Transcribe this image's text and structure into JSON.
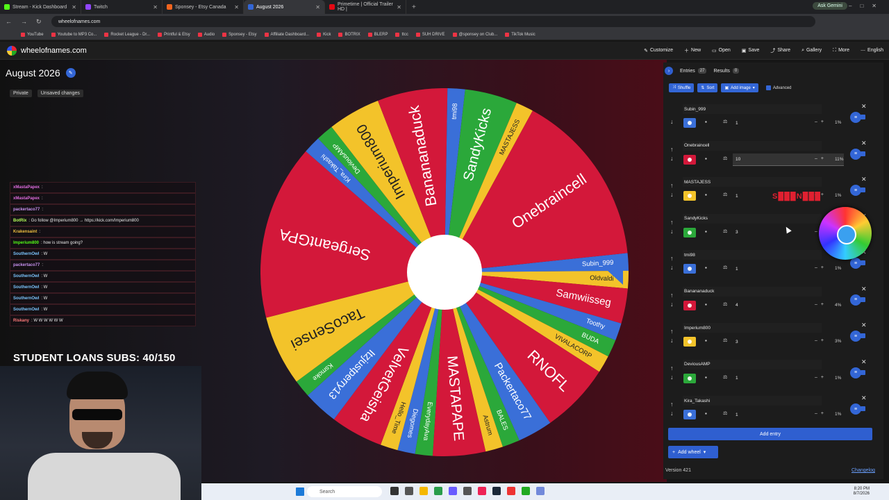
{
  "browser": {
    "tabs": [
      {
        "label": "Stream - Kick Dashboard",
        "color": "#53fc18"
      },
      {
        "label": "Twitch",
        "color": "#9146ff"
      },
      {
        "label": "Sponsey - Etsy Canada",
        "color": "#f1641e"
      },
      {
        "label": "August 2026",
        "color": "#3366d6",
        "active": true
      },
      {
        "label": "Primetime | Official Trailer HD |",
        "color": "#e50914"
      }
    ],
    "ask_gemini": "Ask Gemini",
    "url": "wheelofnames.com",
    "bookmarks": [
      "YouTube",
      "Youtube to MP3 Co...",
      "Rocket League - Dr...",
      "Printful & Etsy",
      "Audio",
      "Sponsey - Etsy",
      "Affiliate Dashboard...",
      "Kick",
      "BOTRIX",
      "BLERP",
      "ttcc",
      "SUH DRIVE",
      "@sponsey on Club...",
      "TikTok Music"
    ]
  },
  "site": {
    "logo": "wheelofnames.com",
    "menu": [
      "Customize",
      "New",
      "Open",
      "Save",
      "Share",
      "Gallery",
      "More",
      "English"
    ]
  },
  "wheel": {
    "title": "August 2026",
    "badges": [
      "Private",
      "Unsaved changes"
    ],
    "segments": [
      {
        "name": "Subin_999",
        "color": "#3a6fd8",
        "weight": 1
      },
      {
        "name": "Oldvaldi",
        "color": "#f3c32a",
        "weight": 1
      },
      {
        "name": "Samwiisseg",
        "color": "#d3183a",
        "weight": 2
      },
      {
        "name": "Toothy",
        "color": "#3a6fd8",
        "weight": 1
      },
      {
        "name": "BUDA",
        "color": "#2ba83a",
        "weight": 1
      },
      {
        "name": "VIVALACORP",
        "color": "#f3c32a",
        "weight": 1
      },
      {
        "name": "RNOFL",
        "color": "#d3183a",
        "weight": 4
      },
      {
        "name": "Packertaco77",
        "color": "#3a6fd8",
        "weight": 2
      },
      {
        "name": "BALES",
        "color": "#2ba83a",
        "weight": 1
      },
      {
        "name": "Astrum",
        "color": "#f3c32a",
        "weight": 1
      },
      {
        "name": "MASTAPAPE",
        "color": "#d3183a",
        "weight": 3
      },
      {
        "name": "EverydayAva",
        "color": "#2ba83a",
        "weight": 1
      },
      {
        "name": "Diegomes",
        "color": "#3a6fd8",
        "weight": 1
      },
      {
        "name": "Hello_Time",
        "color": "#f3c32a",
        "weight": 1
      },
      {
        "name": "VelvetGeisha",
        "color": "#d3183a",
        "weight": 3
      },
      {
        "name": "Itzjustperry13",
        "color": "#3a6fd8",
        "weight": 2
      },
      {
        "name": "Ksmoke",
        "color": "#2ba83a",
        "weight": 1
      },
      {
        "name": "TacoSensei",
        "color": "#f3c32a",
        "weight": 4
      },
      {
        "name": "SergeantGPA",
        "color": "#d3183a",
        "weight": 10
      },
      {
        "name": "Kira_Takashi",
        "color": "#3a6fd8",
        "weight": 1
      },
      {
        "name": "DeviousAMP",
        "color": "#2ba83a",
        "weight": 1
      },
      {
        "name": "Imperium800",
        "color": "#f3c32a",
        "weight": 3
      },
      {
        "name": "Banananaduck",
        "color": "#d3183a",
        "weight": 4
      },
      {
        "name": "tmi98",
        "color": "#3a6fd8",
        "weight": 1
      },
      {
        "name": "SandyKicks",
        "color": "#2ba83a",
        "weight": 3
      },
      {
        "name": "MASTAJESS",
        "color": "#f3c32a",
        "weight": 1
      },
      {
        "name": "Onebraincell",
        "color": "#d3183a",
        "weight": 10
      }
    ]
  },
  "chat": [
    {
      "user": "xMastaPapex",
      "text": ":",
      "color": "#e06de0"
    },
    {
      "user": "xMastaPapex",
      "text": ":",
      "color": "#e06de0"
    },
    {
      "user": "packertaco77",
      "text": ":",
      "color": "#c892f0"
    },
    {
      "user": "BotRix",
      "text": ": Go follow @Imperium800 → https://kick.com/Imperium800",
      "color": "#b4ff5a"
    },
    {
      "user": "Krakensaint",
      "text": ":",
      "color": "#f0c040"
    },
    {
      "user": "Imperium800",
      "text": ": how is stream going?",
      "color": "#53fc18"
    },
    {
      "user": "SouthernOwl",
      "text": ": W",
      "color": "#7cc6ff"
    },
    {
      "user": "packertaco77",
      "text": ":",
      "color": "#c892f0"
    },
    {
      "user": "SouthernOwl",
      "text": ": W",
      "color": "#7cc6ff"
    },
    {
      "user": "SouthernOwl",
      "text": ": W",
      "color": "#7cc6ff"
    },
    {
      "user": "SouthernOwl",
      "text": ": W",
      "color": "#7cc6ff"
    },
    {
      "user": "SouthernOwl",
      "text": ": W",
      "color": "#7cc6ff"
    },
    {
      "user": "Riskany",
      "text": ": W W W W W W",
      "color": "#ff7a7a"
    }
  ],
  "sub_goal": "STUDENT LOANS SUBS: 40/150",
  "panel": {
    "entries_tab": "Entries",
    "entries_count": "27",
    "results_tab": "Results",
    "results_count": "0",
    "shuffle": "Shuffle",
    "sort": "Sort",
    "add_image": "Add image",
    "advanced": "Advanced",
    "entries": [
      {
        "name": "Subin_999",
        "color": "#3a6fd8",
        "weight": "1",
        "pct": "1%"
      },
      {
        "name": "Onebraincell",
        "color": "#d3183a",
        "weight": "10",
        "pct": "11%",
        "focus": true
      },
      {
        "name": "MASTAJESS",
        "color": "#f3c32a",
        "weight": "1",
        "pct": "1%"
      },
      {
        "name": "SandyKicks",
        "color": "#2ba83a",
        "weight": "3",
        "pct": ""
      },
      {
        "name": "tmi98",
        "color": "#3a6fd8",
        "weight": "1",
        "pct": "1%"
      },
      {
        "name": "Banananaduck",
        "color": "#d3183a",
        "weight": "4",
        "pct": "4%"
      },
      {
        "name": "Imperium800",
        "color": "#f3c32a",
        "weight": "3",
        "pct": "3%"
      },
      {
        "name": "DeviousAMP",
        "color": "#2ba83a",
        "weight": "1",
        "pct": "1%"
      },
      {
        "name": "Kira_Takashi",
        "color": "#3a6fd8",
        "weight": "1",
        "pct": "1%"
      }
    ],
    "add_entry": "Add entry",
    "add_wheel": "Add wheel",
    "version": "Version 421",
    "changelog": "Changelog"
  },
  "taskbar": {
    "search": "Search",
    "time": "8:20 PM",
    "date": "8/7/2026"
  }
}
